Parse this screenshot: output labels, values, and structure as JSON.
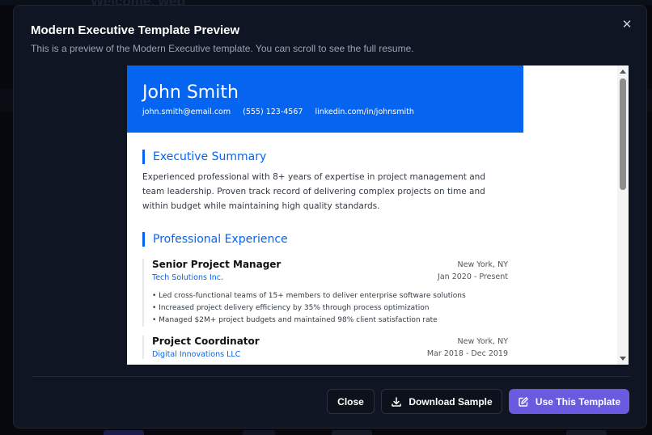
{
  "background": {
    "welcome_text": "Welcome, web"
  },
  "modal": {
    "title": "Modern Executive Template Preview",
    "subtitle": "This is a preview of the Modern Executive template. You can scroll to see the full resume.",
    "close_icon": "close-icon"
  },
  "resume": {
    "name": "John Smith",
    "contact": {
      "email": "john.smith@email.com",
      "phone": "(555) 123-4567",
      "linkedin": "linkedin.com/in/johnsmith"
    },
    "summary_heading": "Executive Summary",
    "summary_text": "Experienced professional with 8+ years of expertise in project management and team leadership. Proven track record of delivering complex projects on time and within budget while maintaining high quality standards.",
    "experience_heading": "Professional Experience",
    "jobs": [
      {
        "title": "Senior Project Manager",
        "company": "Tech Solutions Inc.",
        "location": "New York, NY",
        "dates": "Jan 2020 - Present",
        "bullets": [
          "• Led cross-functional teams of 15+ members to deliver enterprise software solutions",
          "• Increased project delivery efficiency by 35% through process optimization",
          "• Managed $2M+ project budgets and maintained 98% client satisfaction rate"
        ]
      },
      {
        "title": "Project Coordinator",
        "company": "Digital Innovations LLC",
        "location": "New York, NY",
        "dates": "Mar 2018 - Dec 2019"
      }
    ]
  },
  "footer": {
    "close_label": "Close",
    "download_label": "Download Sample",
    "use_label": "Use This Template"
  },
  "colors": {
    "accent": "#0565f0",
    "primary_button": "#6a5ae0",
    "modal_bg": "#0f1522"
  }
}
